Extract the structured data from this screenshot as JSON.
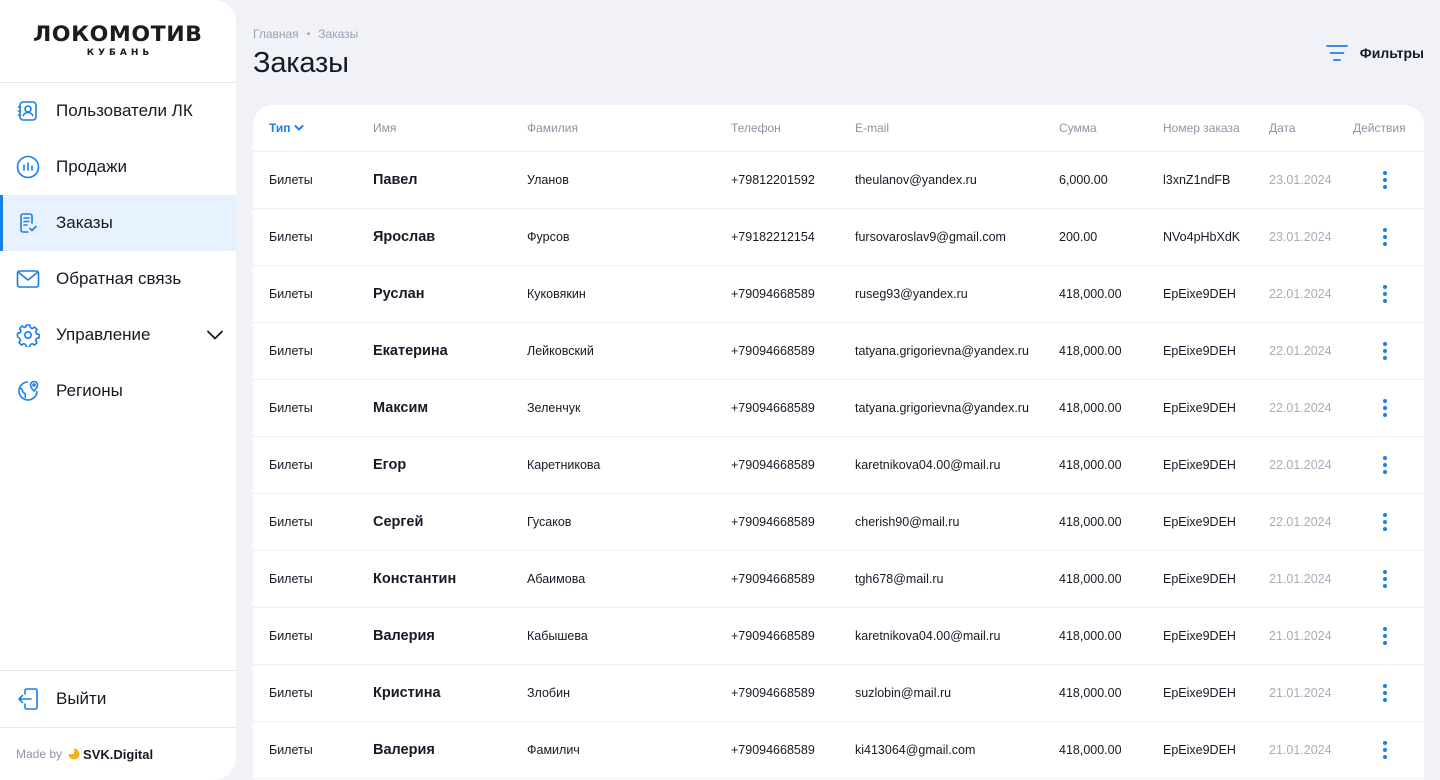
{
  "brand": {
    "logo_main": "ЛОКОМОТИВ",
    "logo_sub": "КУБАНЬ"
  },
  "sidebar": {
    "items": [
      {
        "label": "Пользователи ЛК",
        "icon": "user-card-icon"
      },
      {
        "label": "Продажи",
        "icon": "chart-circle-icon"
      },
      {
        "label": "Заказы",
        "icon": "order-list-icon",
        "active": true
      },
      {
        "label": "Обратная связь",
        "icon": "envelope-icon"
      },
      {
        "label": "Управление",
        "icon": "gear-icon",
        "expandable": true
      },
      {
        "label": "Регионы",
        "icon": "globe-pin-icon"
      }
    ],
    "logout_label": "Выйти",
    "made_by": "Made by",
    "made_by_brand": "SVK.Digital"
  },
  "header": {
    "breadcrumb": [
      "Главная",
      "Заказы"
    ],
    "title": "Заказы",
    "filters_label": "Фильтры"
  },
  "table": {
    "columns": [
      "Тип",
      "Имя",
      "Фамилия",
      "Телефон",
      "E-mail",
      "Сумма",
      "Номер заказа",
      "Дата",
      "Действия"
    ],
    "rows": [
      {
        "type": "Билеты",
        "name": "Павел",
        "surname": "Уланов",
        "phone": "+79812201592",
        "email": "theulanov@yandex.ru",
        "sum": "6,000.00",
        "order": "l3xnZ1ndFB",
        "date": "23.01.2024"
      },
      {
        "type": "Билеты",
        "name": "Ярослав",
        "surname": "Фурсов",
        "phone": "+79182212154",
        "email": "fursovaroslav9@gmail.com",
        "sum": "200.00",
        "order": "NVo4pHbXdK",
        "date": "23.01.2024"
      },
      {
        "type": "Билеты",
        "name": "Руслан",
        "surname": "Куковякин",
        "phone": "+79094668589",
        "email": "ruseg93@yandex.ru",
        "sum": "418,000.00",
        "order": "EpEixe9DEH",
        "date": "22.01.2024"
      },
      {
        "type": "Билеты",
        "name": "Екатерина",
        "surname": "Лейковский",
        "phone": "+79094668589",
        "email": "tatyana.grigorievna@yandex.ru",
        "sum": "418,000.00",
        "order": "EpEixe9DEH",
        "date": "22.01.2024"
      },
      {
        "type": "Билеты",
        "name": "Максим",
        "surname": "Зеленчук",
        "phone": "+79094668589",
        "email": "tatyana.grigorievna@yandex.ru",
        "sum": "418,000.00",
        "order": "EpEixe9DEH",
        "date": "22.01.2024"
      },
      {
        "type": "Билеты",
        "name": "Егор",
        "surname": "Каретникова",
        "phone": "+79094668589",
        "email": "karetnikova04.00@mail.ru",
        "sum": "418,000.00",
        "order": "EpEixe9DEH",
        "date": "22.01.2024"
      },
      {
        "type": "Билеты",
        "name": "Сергей",
        "surname": "Гусаков",
        "phone": "+79094668589",
        "email": "cherish90@mail.ru",
        "sum": "418,000.00",
        "order": "EpEixe9DEH",
        "date": "22.01.2024"
      },
      {
        "type": "Билеты",
        "name": "Константин",
        "surname": "Абаимова",
        "phone": "+79094668589",
        "email": "tgh678@mail.ru",
        "sum": "418,000.00",
        "order": "EpEixe9DEH",
        "date": "21.01.2024"
      },
      {
        "type": "Билеты",
        "name": "Валерия",
        "surname": "Кабышева",
        "phone": "+79094668589",
        "email": "karetnikova04.00@mail.ru",
        "sum": "418,000.00",
        "order": "EpEixe9DEH",
        "date": "21.01.2024"
      },
      {
        "type": "Билеты",
        "name": "Кристина",
        "surname": "Злобин",
        "phone": "+79094668589",
        "email": "suzlobin@mail.ru",
        "sum": "418,000.00",
        "order": "EpEixe9DEH",
        "date": "21.01.2024"
      },
      {
        "type": "Билеты",
        "name": "Валерия",
        "surname": "Фамилич",
        "phone": "+79094668589",
        "email": "ki413064@gmail.com",
        "sum": "418,000.00",
        "order": "EpEixe9DEH",
        "date": "21.01.2024"
      }
    ]
  },
  "colors": {
    "accent": "#1b7fe3",
    "active_bg": "#e8f2fe",
    "page_bg": "#f1f2f7"
  }
}
